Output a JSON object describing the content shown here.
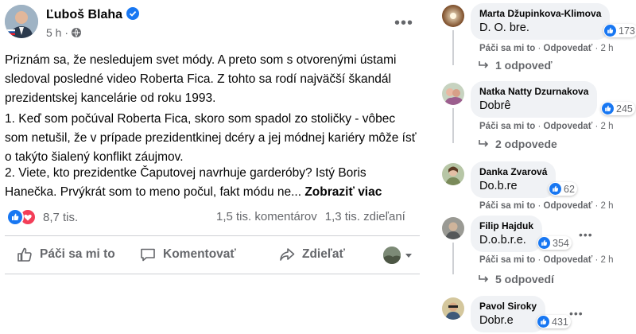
{
  "post": {
    "author": "Ľuboš Blaha",
    "time": "5 h ·",
    "paragraphs": [
      "Priznám sa, že nesledujem svet módy. A preto som s otvorenými ústami sledoval posledné video Roberta Fica. Z tohto sa rodí najväčší škandál prezidentskej kancelárie od roku 1993.",
      "1. Keď som počúval Roberta Fica, skoro som spadol zo stoličky - vôbec som netušil, že v prípade prezidentkinej dcéry a jej módnej kariéry môže ísť o takýto šialený konflikt záujmov.",
      "2. Viete, kto prezidentke Čaputovej navrhuje garderóby? Istý Boris Hanečka. Prvýkrát som to meno počul, fakt módu ne..."
    ],
    "see_more": "Zobraziť viac",
    "reactions_count": "8,7 tis.",
    "comments_count": "1,5 tis. komentárov",
    "shares_count": "1,3 tis. zdieľaní",
    "actions": {
      "like": "Páči sa mi to",
      "comment": "Komentovať",
      "share": "Zdieľať"
    }
  },
  "comments": [
    {
      "name": "Marta Džupinkova-Klimova",
      "text": "D. O. bre.",
      "reactions": "173",
      "like": "Páči sa mi to",
      "reply": "Odpovedať",
      "time": "2 h",
      "replies": "1 odpoveď"
    },
    {
      "name": "Natka Natty Dzurnakova",
      "text": "Dobrê",
      "reactions": "245",
      "like": "Páči sa mi to",
      "reply": "Odpovedať",
      "time": "2 h",
      "replies": "2 odpovede"
    },
    {
      "name": "Danka Zvarová",
      "text": "Do.b.re",
      "reactions": "62",
      "like": "Páči sa mi to",
      "reply": "Odpovedať",
      "time": "2 h",
      "replies": ""
    },
    {
      "name": "Filip Hajduk",
      "text": "D.o.b.r.e.",
      "reactions": "354",
      "like": "Páči sa mi to",
      "reply": "Odpovedať",
      "time": "2 h",
      "replies": "5 odpovedí"
    },
    {
      "name": "Pavol Siroky",
      "text": "Dobr.e",
      "reactions": "431",
      "like": "",
      "reply": "",
      "time": "",
      "replies": ""
    }
  ],
  "colors": {
    "brand_blue": "#1877f2",
    "love_red": "#f33e58",
    "secondary_text": "#65676b",
    "bubble_bg": "#f0f2f5"
  }
}
